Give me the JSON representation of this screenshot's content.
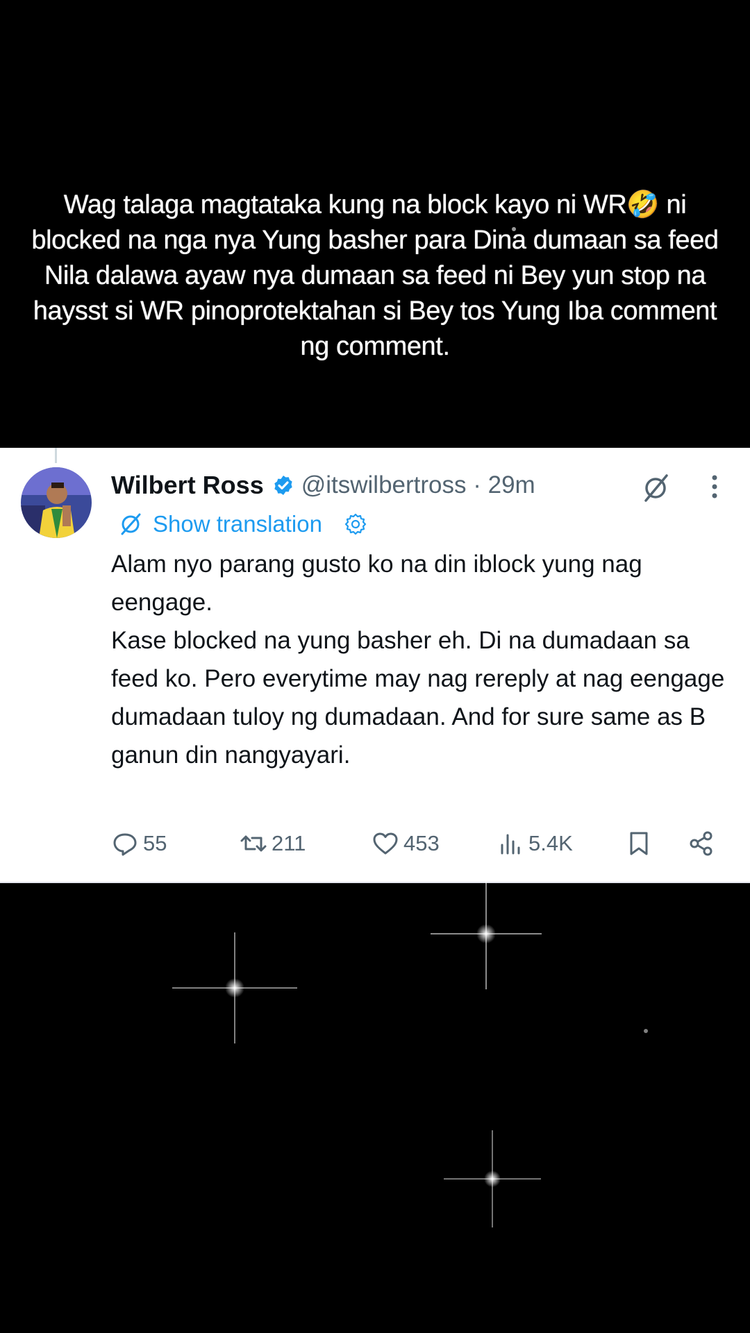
{
  "caption": {
    "text": "Wag talaga magtataka kung na block kayo ni WR🤣 ni blocked na nga nya Yung basher para Dina dumaan sa feed Nila dalawa ayaw nya dumaan sa feed ni Bey yun stop na haysst si WR pinoprotektahan si Bey tos Yung Iba comment ng comment."
  },
  "tweet": {
    "display_name": "Wilbert Ross",
    "handle": "@itswilbertross · 29m",
    "show_translation": "Show translation",
    "text_line1": "Alam nyo parang gusto ko na din iblock yung nag eengage.",
    "text_line2": "Kase blocked na yung basher eh. Di na dumadaan sa feed ko. Pero everytime may nag rereply at nag eengage dumadaan tuloy ng dumadaan. And for sure same as B ganun din nangyayari.",
    "replies": "55",
    "reposts": "211",
    "likes": "453",
    "views": "5.4K"
  },
  "icons": {
    "verified": "verified-badge-icon",
    "grok": "grok-icon",
    "more": "more-icon",
    "translate": "translate-icon",
    "settings": "gear-icon",
    "reply": "reply-icon",
    "repost": "repost-icon",
    "like": "heart-icon",
    "views": "views-icon",
    "bookmark": "bookmark-icon",
    "share": "share-icon"
  },
  "colors": {
    "background": "#000000",
    "card": "#ffffff",
    "verified": "#1d9bf0",
    "link": "#1d9bf0",
    "text": "#0f1419",
    "muted": "#536471"
  }
}
